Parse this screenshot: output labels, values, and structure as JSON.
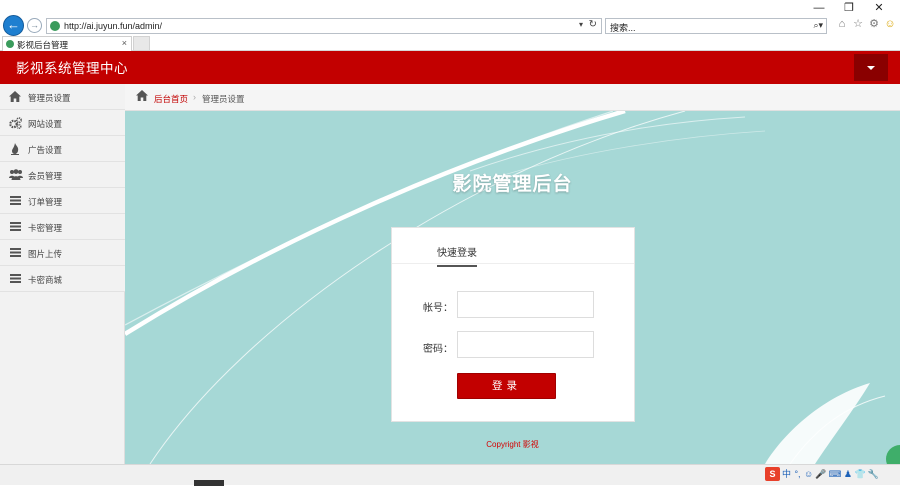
{
  "browser": {
    "url": "http://ai.juyun.fun/admin/",
    "search_placeholder": "搜索...",
    "tab_title": "影视后台管理",
    "tab_close": "×",
    "back_glyph": "←",
    "forward_glyph": "→",
    "dropdown_glyph": "▾",
    "refresh_glyph": "↻",
    "search_glyph": "⌕▾",
    "window_controls": {
      "minimize": "—",
      "restore": "❐",
      "close": "✕"
    },
    "tool_icons": [
      "home-icon",
      "star-icon",
      "gear-icon",
      "smiley-icon"
    ]
  },
  "header": {
    "title": "影视系统管理中心"
  },
  "sidebar": {
    "items": [
      {
        "label": "管理员设置",
        "icon": "home-icon"
      },
      {
        "label": "网站设置",
        "icon": "cogs-icon"
      },
      {
        "label": "广告设置",
        "icon": "fire-icon"
      },
      {
        "label": "会员管理",
        "icon": "users-icon"
      },
      {
        "label": "订单管理",
        "icon": "list-icon"
      },
      {
        "label": "卡密管理",
        "icon": "list-icon"
      },
      {
        "label": "图片上传",
        "icon": "list-icon"
      },
      {
        "label": "卡密商城",
        "icon": "list-icon"
      }
    ]
  },
  "breadcrumb": {
    "home": "后台首页",
    "separator": "›",
    "current": "管理员设置"
  },
  "login": {
    "heading": "影院管理后台",
    "tab": "快速登录",
    "account_label": "帐号：",
    "password_label": "密码：",
    "account_value": "",
    "password_value": "",
    "submit": "登录"
  },
  "footer": {
    "copyright": "Copyright 影视"
  },
  "taskbar": {
    "ime": [
      "S",
      "中",
      "°,",
      "☺",
      "🎤",
      "⌨",
      "♟",
      "👕",
      "🔧"
    ]
  },
  "colors": {
    "brand_red": "#c20000",
    "header_dark": "#8a0000",
    "content_bg": "#a6d8d6",
    "sidebar_bg": "#f2f2f2"
  }
}
